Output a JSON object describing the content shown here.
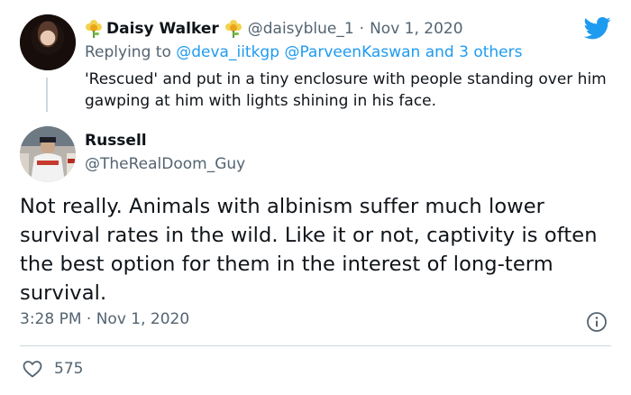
{
  "parent_tweet": {
    "author_name": "Daisy Walker",
    "handle": "@daisyblue_1",
    "separator": "·",
    "date": "Nov 1, 2020",
    "replying_prefix": "Replying to",
    "replying_to_1": "@deva_iitkgp",
    "replying_to_2": "@ParveenKaswan",
    "replying_suffix": "and 3 others",
    "text": "'Rescued' and put in a tiny enclosure with people standing over him gawping at him with lights shining in his face."
  },
  "main_tweet": {
    "author_name": "Russell",
    "handle": "@TheRealDoom_Guy",
    "text": "Not really. Animals with albinism suffer much lower survival rates in the wild. Like it or not, captivity is often the best option for them in the interest of long-term survival.",
    "timestamp": "3:28 PM · Nov 1, 2020",
    "like_count": "575"
  },
  "icons": {
    "logo": "twitter-bird-icon",
    "info": "info-icon",
    "like": "heart-icon",
    "emoji": "sunflower-emoji-icon"
  },
  "colors": {
    "brand": "#1d9bf0",
    "secondary_text": "#536471",
    "divider": "#cfd9de"
  }
}
